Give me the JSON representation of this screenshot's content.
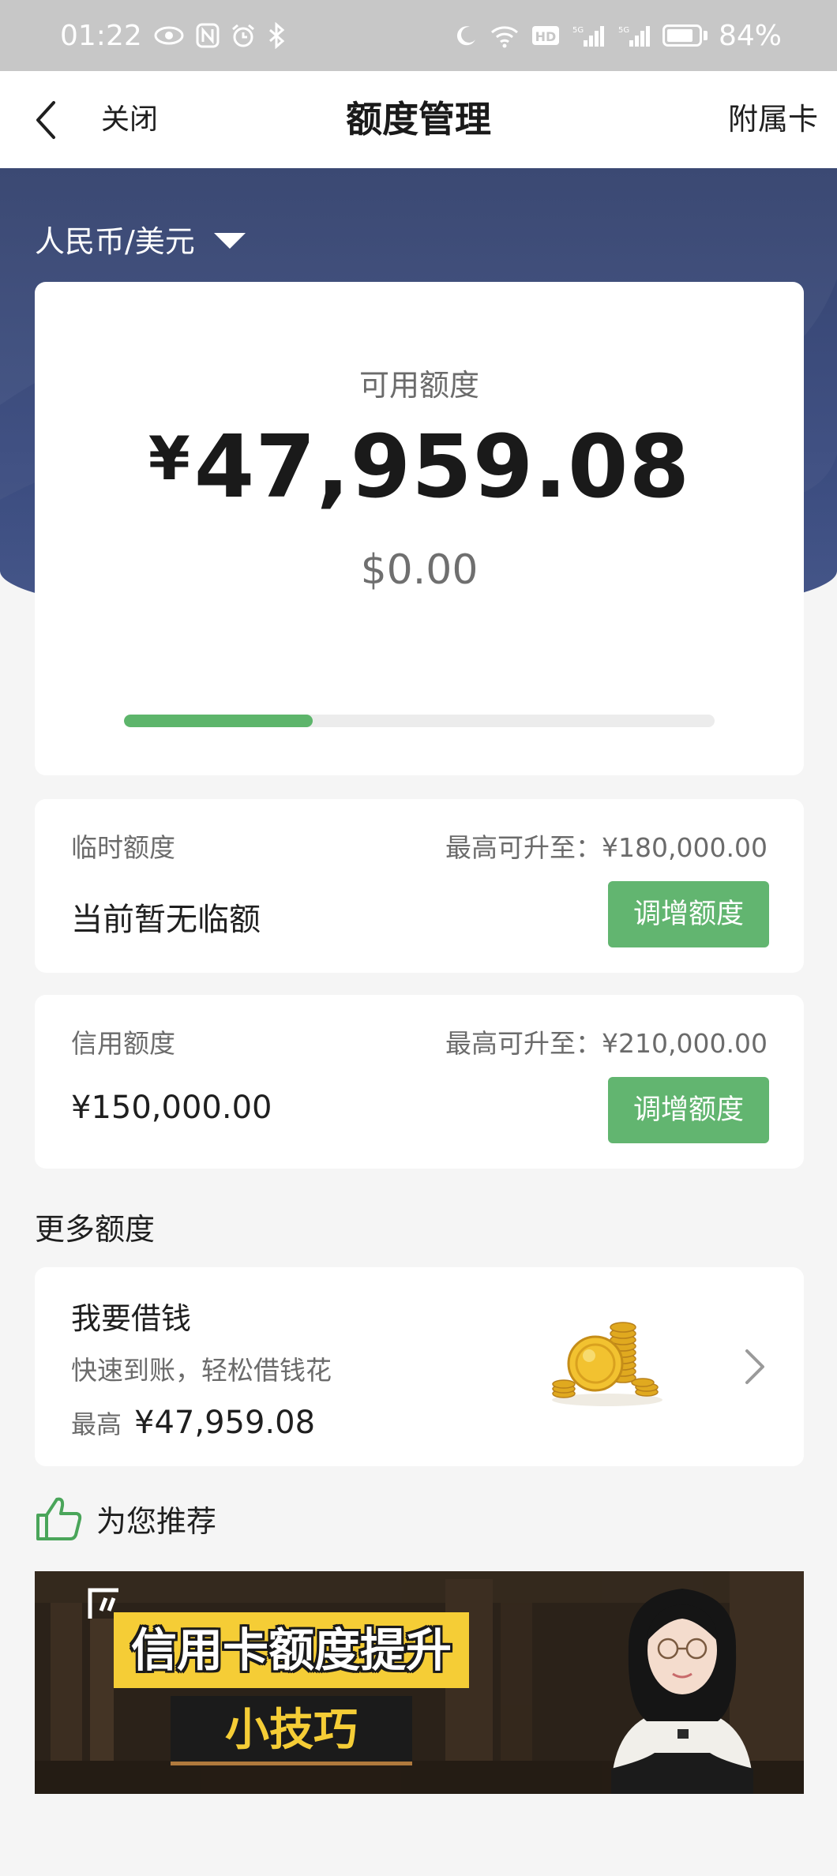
{
  "status_bar": {
    "time": "01:22",
    "battery_text": "84%",
    "battery_level": 0.84,
    "icons": [
      "eye-icon",
      "nfc-icon",
      "alarm-icon",
      "bluetooth-icon",
      "moon-icon",
      "wifi-icon",
      "hd-icon",
      "signal-icon",
      "signal-icon",
      "battery-icon"
    ]
  },
  "nav": {
    "close_label": "关闭",
    "title": "额度管理",
    "secondary_label": "附属卡"
  },
  "currency": {
    "selected": "人民币/美元"
  },
  "available": {
    "label": "可用额度",
    "currency_symbol": "¥",
    "amount": "47,959.08",
    "usd_amount": "$0.00",
    "progress_fraction": 0.32
  },
  "temp_limit": {
    "label": "临时额度",
    "max_text": "最高可升至：¥180,000.00",
    "value": "当前暂无临额",
    "button_label": "调增额度"
  },
  "credit_limit": {
    "label": "信用额度",
    "max_text": "最高可升至：¥210,000.00",
    "value": "¥150,000.00",
    "button_label": "调增额度"
  },
  "more_limits": {
    "section_title": "更多额度",
    "loan": {
      "title": "我要借钱",
      "subtitle": "快速到账，轻松借钱花",
      "max_label": "最高",
      "max_value": "¥47,959.08"
    }
  },
  "recommend": {
    "section_title": "为您推荐",
    "banner": {
      "main_text": "信用卡额度提升",
      "sub_text": "小技巧"
    }
  },
  "colors": {
    "hero_blue": "#2d3d6a",
    "accent_green": "#62b570",
    "progress_green": "#5db56b",
    "banner_yellow": "#f5cd36"
  }
}
